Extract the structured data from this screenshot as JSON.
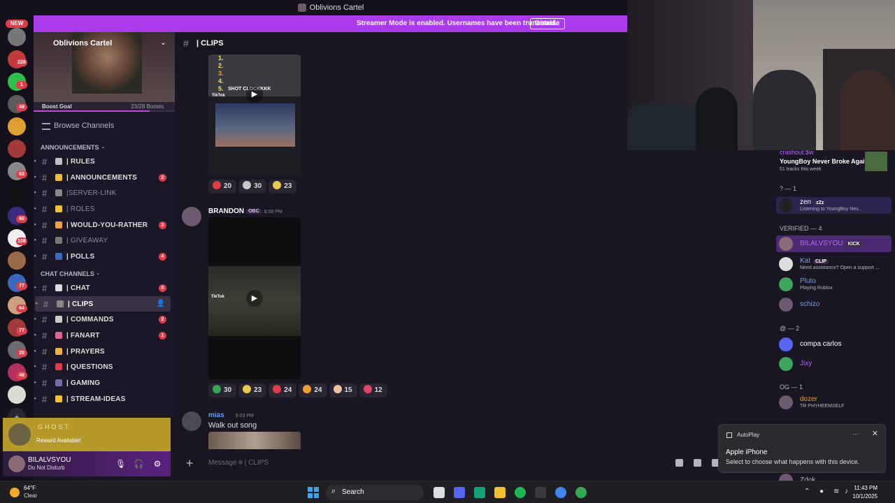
{
  "window": {
    "server_title": "Oblivions Cartel"
  },
  "streamer_banner": {
    "text": "Streamer Mode is enabled. Usernames have been truncated.",
    "disable_label": "Disable"
  },
  "server_rail": {
    "new_label": "NEW",
    "badges": [
      "226",
      "1",
      "49",
      "63",
      "60",
      "108",
      "77",
      "64",
      "77",
      "20",
      "48"
    ]
  },
  "sidebar": {
    "server_name": "Oblivions Cartel",
    "boost_goal_label": "Boost Goal",
    "boost_goal_value": "23/28 Boosts",
    "boost_progress": 0.82,
    "browse_label": "Browse Channels",
    "categories": [
      {
        "label": "ANNOUNCEMENTS",
        "channels": [
          {
            "label": "| RULES",
            "count": "",
            "muted": false
          },
          {
            "label": "| ANNOUNCEMENTS",
            "count": "2",
            "muted": false
          },
          {
            "label": "|SERVER-LINK",
            "count": "",
            "muted": true
          },
          {
            "label": "| ROLES",
            "count": "",
            "muted": true
          },
          {
            "label": "| WOULD-YOU-RATHER",
            "count": "3",
            "muted": false
          },
          {
            "label": "| GIVEAWAY",
            "count": "",
            "muted": true
          },
          {
            "label": "| POLLS",
            "count": "4",
            "muted": false
          }
        ]
      },
      {
        "label": "CHAT CHANNELS",
        "channels": [
          {
            "label": "| CHAT",
            "count": "5",
            "muted": false
          },
          {
            "label": "| CLIPS",
            "count": "",
            "muted": false,
            "active": true
          },
          {
            "label": "| COMMANDS",
            "count": "2",
            "muted": false
          },
          {
            "label": "| FANART",
            "count": "1",
            "muted": false
          },
          {
            "label": "| PRAYERS",
            "count": "",
            "muted": false
          },
          {
            "label": "| QUESTIONS",
            "count": "",
            "muted": false
          },
          {
            "label": "| GAMING",
            "count": "",
            "muted": false
          },
          {
            "label": "| STREAM-IDEAS",
            "count": "",
            "muted": false
          }
        ]
      }
    ]
  },
  "ghost_widget": {
    "title": "GHOST",
    "subtitle": "Reward Available!"
  },
  "user_panel": {
    "name": "BILALVSYOU",
    "status": "Do Not Disturb"
  },
  "channel_header": {
    "name": "| CLIPS"
  },
  "messages": {
    "video1_overlay_lines": [
      "1.",
      "2.",
      "3.",
      "4.",
      "5."
    ],
    "video1_caption": "SHOT CLOCKKKK",
    "video_brand": "TikTok",
    "reactions1": [
      {
        "count": "20",
        "color": "#e03d4a"
      },
      {
        "count": "30",
        "color": "#c8c8c8"
      },
      {
        "count": "23",
        "color": "#e8c94a"
      }
    ],
    "msg2": {
      "author": "BRANDON",
      "tag": "OBC",
      "time": "8:58 PM"
    },
    "reactions2": [
      {
        "count": "30",
        "color": "#3ba55c"
      },
      {
        "count": "23",
        "color": "#e8c94a"
      },
      {
        "count": "24",
        "color": "#e03d4a"
      },
      {
        "count": "24",
        "color": "#f29d30"
      },
      {
        "count": "15",
        "color": "#f0c0a0"
      },
      {
        "count": "12",
        "color": "#e0486a"
      }
    ],
    "msg3": {
      "author": "mias",
      "time": "9:03 PM",
      "text": "Walk out song"
    }
  },
  "composer": {
    "placeholder": "Message # | CLIPS"
  },
  "members": {
    "now_playing_user": "crashout.$w",
    "now_playing_title": "YoungBoy Never Broke Again",
    "now_playing_sub": "51 tracks this week",
    "groups": [
      {
        "label": "? — 1"
      },
      {
        "label": "VERIFIED — 4"
      },
      {
        "label": "@ — 2"
      },
      {
        "label": "OG — 1"
      }
    ],
    "list": [
      {
        "name": "zen",
        "badge": "zZz",
        "sub": "Listening to YoungBoy Nev...",
        "color": "#ffffff"
      },
      {
        "name": "BILALVSYOU",
        "badge": "KICK",
        "sub": "",
        "color": "#b56af0"
      },
      {
        "name": "Kat",
        "badge": "CLIP",
        "sub": "Need assistance? Open a support ...",
        "color": "#6aa0f0"
      },
      {
        "name": "Pluto",
        "badge": "",
        "sub": "Playing Roblox",
        "color": "#6aa0f0"
      },
      {
        "name": "schizo",
        "badge": "",
        "sub": "",
        "color": "#6aa0f0"
      },
      {
        "name": "compa carlos",
        "badge": "",
        "sub": "",
        "color": "#ffffff"
      },
      {
        "name": "Jixy",
        "badge": "",
        "sub": "",
        "color": "#b56af0"
      },
      {
        "name": "dozer",
        "badge": "",
        "sub": "TR PHYHEEMSELF",
        "color": "#e0a030"
      },
      {
        "name": "Zdok",
        "badge": "",
        "sub": "",
        "color": "#b5b5c0"
      }
    ]
  },
  "toast": {
    "app": "AutoPlay",
    "title": "Apple iPhone",
    "body": "Select to choose what happens with this device."
  },
  "taskbar": {
    "weather_temp": "64°F",
    "weather_cond": "Clear",
    "search_label": "Search",
    "time": "11:43 PM",
    "date": "10/1/2025"
  }
}
